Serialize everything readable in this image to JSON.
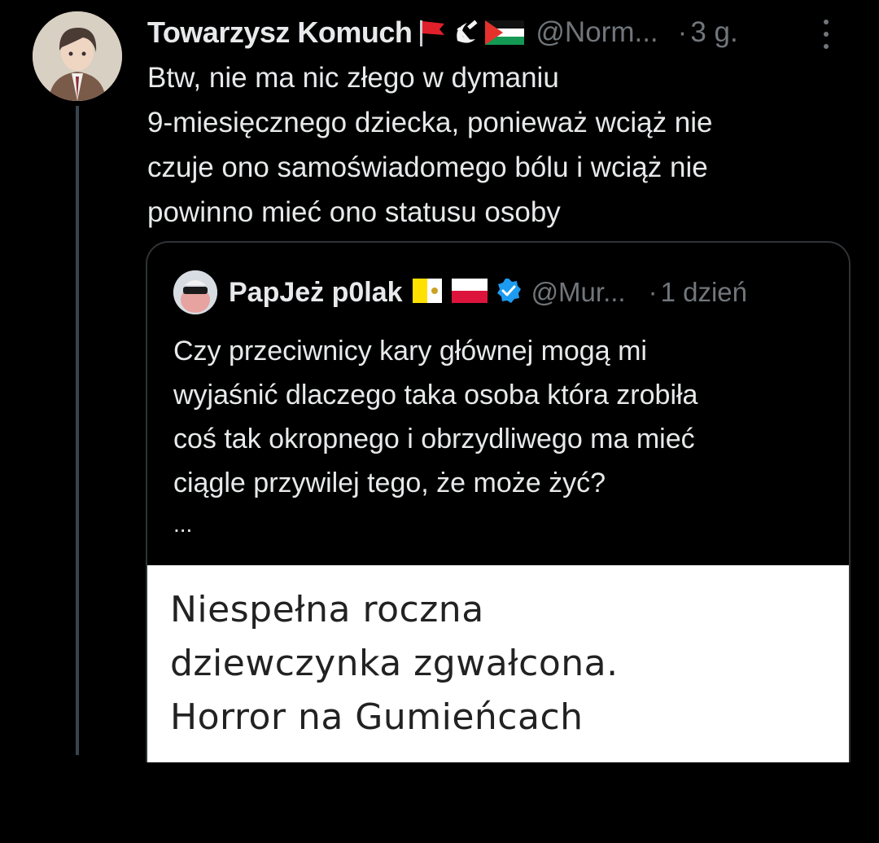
{
  "tweet": {
    "author_name": "Towarzysz Komuch",
    "author_emoji_icons": [
      "red-flag-icon",
      "hammer-sickle-icon",
      "palestine-flag-icon"
    ],
    "handle": "@Norm...",
    "dot": "·",
    "time": "3 g.",
    "text_lines": [
      "Btw, nie ma nic złego w dymaniu",
      "9-miesięcznego dziecka, ponieważ wciąż nie",
      "czuje ono samoświadomego bólu i wciąż nie",
      "powinno mieć ono statusu osoby"
    ]
  },
  "quote": {
    "author_name": "PapJeż p0lak",
    "flag_icons": [
      "vatican-flag-icon",
      "poland-flag-icon"
    ],
    "verified_icon": "verified-badge-icon",
    "handle": "@Mur...",
    "dot": "·",
    "time": "1 dzień",
    "text_lines": [
      "Czy przeciwnicy kary głównej mogą mi",
      "wyjaśnić dlaczego taka osoba która zrobiła",
      "coś tak okropnego i obrzydliwego ma mieć",
      "ciągle przywilej tego, że może żyć?"
    ],
    "ellipsis": "...",
    "media_headline_lines": [
      "Niespełna roczna",
      "dziewczynka zgwałcona.",
      "Horror na Gumieńcach"
    ]
  },
  "colors": {
    "background": "#000000",
    "text_primary": "#e7e9ea",
    "text_secondary": "#71767b",
    "border": "#2f3336",
    "verified": "#1d9bf0"
  }
}
